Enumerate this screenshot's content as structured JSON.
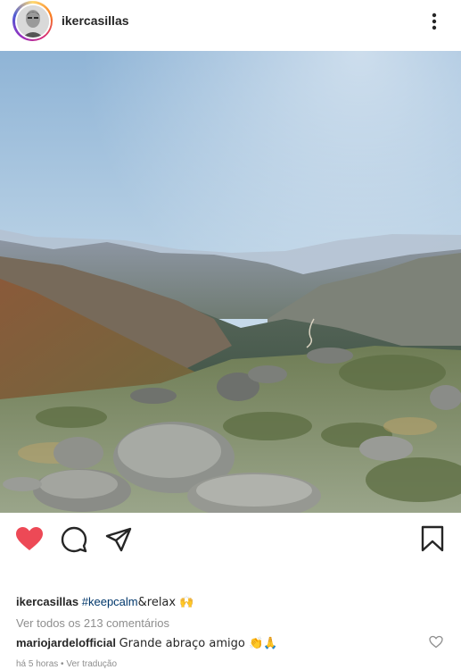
{
  "post": {
    "username": "ikercasillas"
  },
  "caption": {
    "username": "ikercasillas",
    "hashtag": "#keepcalm",
    "text": "&relax 🙌"
  },
  "comments": {
    "view_all": "Ver todos os 213 comentários",
    "top_comment": {
      "username": "mariojardelofficial",
      "text": "Grande abraço amigo 👏🙏"
    }
  },
  "meta": {
    "time": "há 5 horas",
    "separator": "•",
    "translate": "Ver tradução"
  },
  "icons": {
    "like": "heart-icon",
    "comment": "comment-icon",
    "share": "share-icon",
    "save": "bookmark-icon",
    "more": "more-vertical-icon"
  },
  "colors": {
    "like": "#ed4956",
    "hashtag": "#00376b",
    "muted": "#8e8e8e"
  }
}
